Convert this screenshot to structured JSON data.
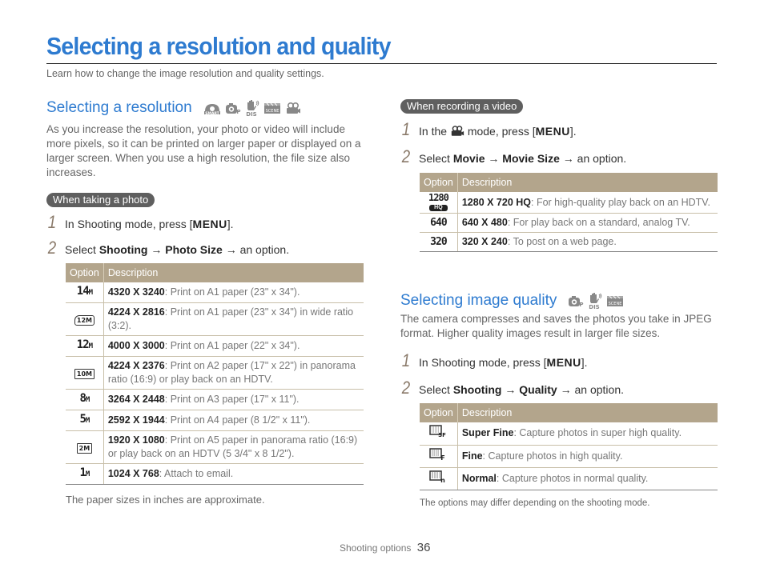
{
  "page": {
    "title": "Selecting a resolution and quality",
    "subtitle": "Learn how to change the image resolution and quality settings."
  },
  "resolution": {
    "heading": "Selecting a resolution",
    "mode_icons": [
      "smart-auto-icon",
      "program-icon",
      "dual-is-icon",
      "scene-icon",
      "movie-icon"
    ],
    "intro": "As you increase the resolution, your photo or video will include more pixels, so it can be printed on larger paper or displayed on a larger screen. When you use a high resolution, the file size also increases.",
    "photo": {
      "pill": "When taking a photo",
      "steps": [
        {
          "num": "1",
          "pre": "In Shooting mode, press [",
          "key": "MENU",
          "post": "]."
        },
        {
          "num": "2",
          "pre": "Select ",
          "b1": "Shooting",
          "arrow1": " → ",
          "b2": "Photo Size",
          "post": " → an option."
        }
      ],
      "table": {
        "headers": [
          "Option",
          "Description"
        ],
        "rows": [
          {
            "icon": "14M",
            "icon_name": "14m-icon",
            "bold": "4320 X 3240",
            "text": ": Print on A1 paper (23\" x 34\")."
          },
          {
            "icon": "12M",
            "icon_name": "12m-wide-icon",
            "bold": "4224 X 2816",
            "text": ": Print on A1 paper (23\" x 34\") in wide ratio (3:2)."
          },
          {
            "icon": "12M",
            "icon_name": "12m-icon",
            "bold": "4000 X 3000",
            "text": ": Print on A1 paper (22\" x 34\")."
          },
          {
            "icon": "10M",
            "icon_name": "10m-panorama-icon",
            "bold": "4224 X 2376",
            "text": ": Print on A2 paper (17\" x 22\") in panorama ratio (16:9) or play back on an HDTV."
          },
          {
            "icon": "8M",
            "icon_name": "8m-icon",
            "bold": "3264 X 2448",
            "text": ": Print on A3 paper (17\" x 11\")."
          },
          {
            "icon": "5M",
            "icon_name": "5m-icon",
            "bold": "2592 X 1944",
            "text": ": Print on A4 paper (8 1/2\" x 11\")."
          },
          {
            "icon": "2M",
            "icon_name": "2m-panorama-icon",
            "bold": "1920 X 1080",
            "text": ": Print on A5 paper in panorama ratio (16:9) or play back on an HDTV (5 3/4\" x 8 1/2\")."
          },
          {
            "icon": "1M",
            "icon_name": "1m-icon",
            "bold": "1024 X 768",
            "text": ": Attach to email."
          }
        ]
      },
      "note": "The paper sizes in inches are approximate."
    },
    "video": {
      "pill": "When recording a video",
      "steps": [
        {
          "num": "1",
          "pre": "In the ",
          "icon": "movie-icon",
          "mid": " mode, press [",
          "key": "MENU",
          "post": "]."
        },
        {
          "num": "2",
          "pre": "Select ",
          "b1": "Movie",
          "arrow1": " → ",
          "b2": "Movie Size",
          "post": " → an option."
        }
      ],
      "table": {
        "headers": [
          "Option",
          "Description"
        ],
        "rows": [
          {
            "icon": "1280",
            "icon_sub": "HQ",
            "icon_name": "1280-hq-icon",
            "bold": "1280 X 720 HQ",
            "text": ": For high-quality play back on an HDTV."
          },
          {
            "icon": "640",
            "icon_name": "640-icon",
            "bold": "640 X 480",
            "text": ": For play back on a standard, analog TV."
          },
          {
            "icon": "320",
            "icon_name": "320-icon",
            "bold": "320 X 240",
            "text": ": To post on a web page."
          }
        ]
      }
    }
  },
  "quality": {
    "heading": "Selecting image quality",
    "mode_icons": [
      "program-icon",
      "dual-is-icon",
      "scene-icon"
    ],
    "intro": "The camera compresses and saves the photos you take in JPEG format. Higher quality images result in larger file sizes.",
    "steps": [
      {
        "num": "1",
        "pre": "In Shooting mode, press [",
        "key": "MENU",
        "post": "]."
      },
      {
        "num": "2",
        "pre": "Select ",
        "b1": "Shooting",
        "arrow1": " → ",
        "b2": "Quality",
        "post": " → an option."
      }
    ],
    "table": {
      "headers": [
        "Option",
        "Description"
      ],
      "rows": [
        {
          "icon": "SF",
          "icon_name": "super-fine-icon",
          "bold": "Super Fine",
          "text": ": Capture photos in super high quality."
        },
        {
          "icon": "F",
          "icon_name": "fine-icon",
          "bold": "Fine",
          "text": ": Capture photos in high quality."
        },
        {
          "icon": "N",
          "icon_name": "normal-icon",
          "bold": "Normal",
          "text": ": Capture photos in normal quality."
        }
      ]
    },
    "note": "The options may differ depending on the shooting mode."
  },
  "footer": {
    "section": "Shooting options",
    "page_number": "36"
  }
}
